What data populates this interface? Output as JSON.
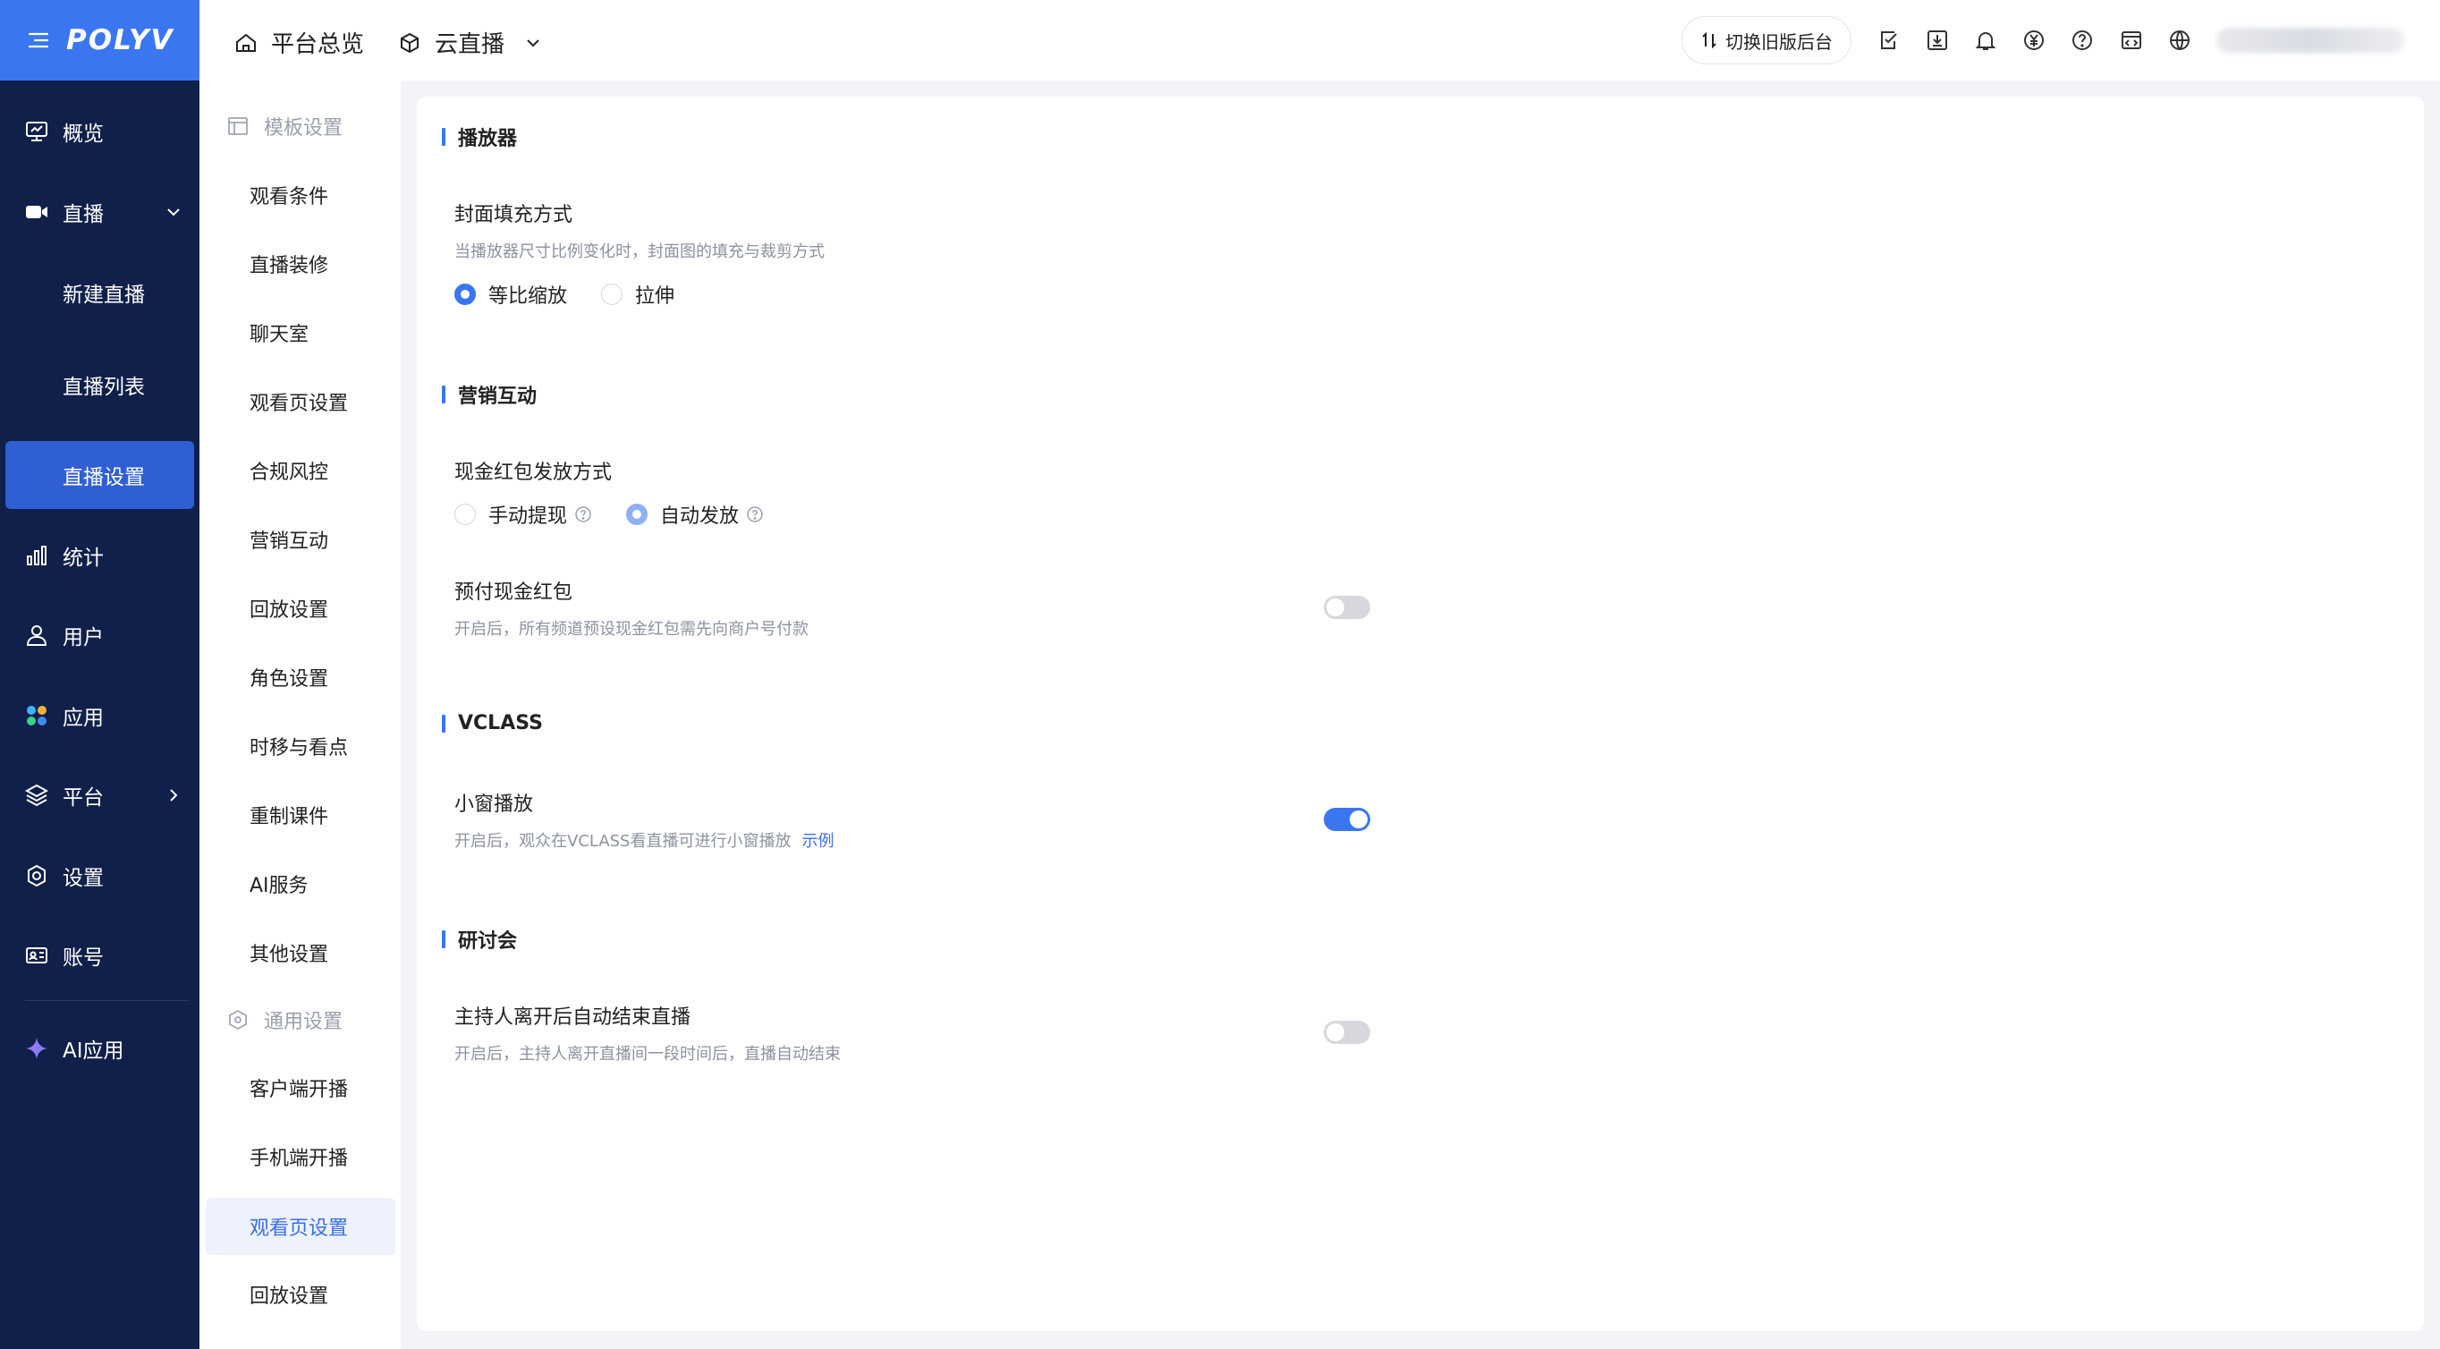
{
  "brand": {
    "logo": "POLYV"
  },
  "left_nav": {
    "items": [
      {
        "label": "概览",
        "icon": "monitor-icon"
      },
      {
        "label": "直播",
        "icon": "video-camera-icon"
      },
      {
        "label": "新建直播"
      },
      {
        "label": "直播列表"
      },
      {
        "label": "直播设置"
      },
      {
        "label": "统计",
        "icon": "bar-chart-icon"
      },
      {
        "label": "用户",
        "icon": "user-icon"
      },
      {
        "label": "应用",
        "icon": "apps-icon"
      },
      {
        "label": "平台",
        "icon": "layers-icon"
      },
      {
        "label": "设置",
        "icon": "gear-icon"
      },
      {
        "label": "账号",
        "icon": "id-card-icon"
      },
      {
        "label": "AI应用",
        "icon": "sparkle-icon"
      }
    ]
  },
  "topbar": {
    "home_label": "平台总览",
    "product_label": "云直播",
    "switch_label": "切换旧版后台"
  },
  "second_nav": {
    "group1": "模板设置",
    "items1": [
      "观看条件",
      "直播装修",
      "聊天室",
      "观看页设置",
      "合规风控",
      "营销互动",
      "回放设置",
      "角色设置",
      "时移与看点",
      "重制课件",
      "AI服务",
      "其他设置"
    ],
    "group2": "通用设置",
    "items2": [
      "客户端开播",
      "手机端开播",
      "观看页设置",
      "回放设置"
    ]
  },
  "main": {
    "player": {
      "title": "播放器",
      "cover_label": "封面填充方式",
      "cover_desc": "当播放器尺寸比例变化时，封面图的填充与裁剪方式",
      "opt_scale": "等比缩放",
      "opt_stretch": "拉伸"
    },
    "marketing": {
      "title": "营销互动",
      "redpack_label": "现金红包发放方式",
      "opt_manual": "手动提现",
      "opt_auto": "自动发放",
      "prepaid_label": "预付现金红包",
      "prepaid_desc": "开启后，所有频道预设现金红包需先向商户号付款",
      "prepaid_on": false
    },
    "vclass": {
      "title": "VCLASS",
      "mini_label": "小窗播放",
      "mini_desc": "开启后，观众在VCLASS看直播可进行小窗播放",
      "mini_link": "示例",
      "mini_on": true
    },
    "seminar": {
      "title": "研讨会",
      "host_label": "主持人离开后自动结束直播",
      "host_desc": "开启后，主持人离开直播间一段时间后，直播自动结束",
      "host_on": false
    }
  },
  "colors": {
    "accent": "#3a76f0",
    "sidebar": "#10204a",
    "active_nav": "#2f5fd3"
  }
}
